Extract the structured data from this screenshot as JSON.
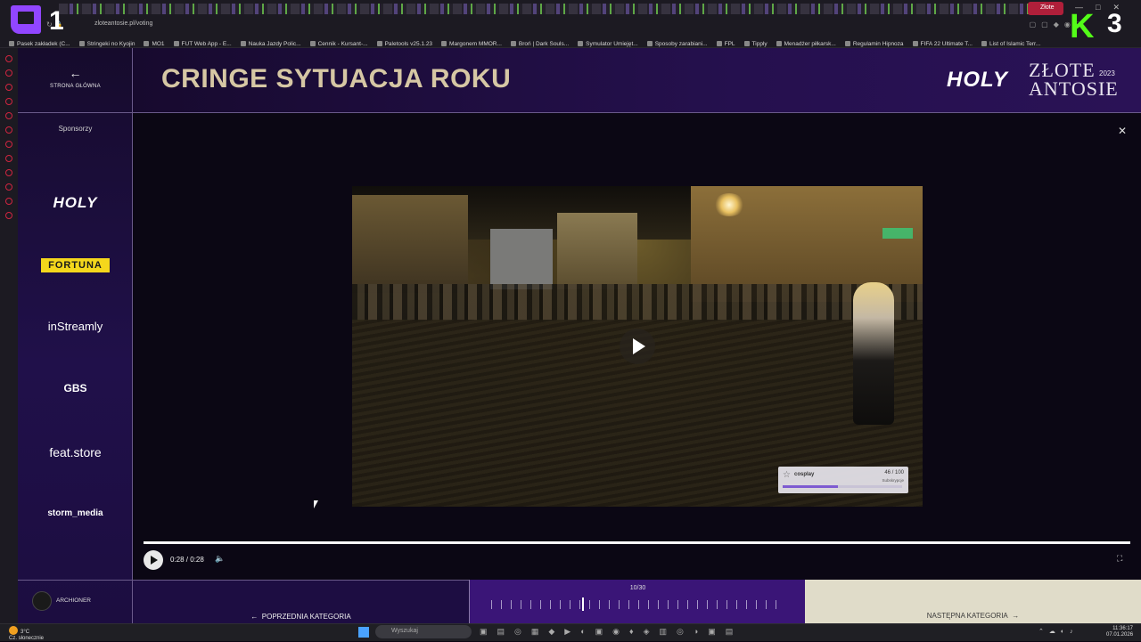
{
  "browser": {
    "url": "zloteantosie.pl/voting",
    "active_tab": "Złote",
    "bookmarks": [
      "Pasek zakładek (C...",
      "Stringeki no Kyojin",
      "MO1",
      "FUT Web App - E...",
      "Nauka Jazdy Polic...",
      "Cennik - Kursant-...",
      "Paletools v25.1.23",
      "Margonem MMOR...",
      "Broń | Dark Souls...",
      "Symulator Umiejęt...",
      "Sposoby zarabiani...",
      "FPL",
      "Tipply",
      "Menadżer piłkarsk...",
      "Regulamin Hipnoza",
      "FIFA 22 Ultimate T...",
      "List of Islamic Terr..."
    ]
  },
  "overlay": {
    "left_number": "1",
    "right_number": "3",
    "right_logo": "K"
  },
  "nav": {
    "home_label": "STRONA GŁÓWNA",
    "sponsors_title": "Sponsorzy"
  },
  "sponsors": {
    "holy": "HOLY",
    "fortuna": "FORTUNA",
    "instreamly": "inStreamly",
    "gbs": "GBS",
    "feat": "feat.store",
    "storm": "storm_media"
  },
  "user": {
    "name": "ARCHIONER"
  },
  "header": {
    "title": "CRINGE SYTUACJA ROKU",
    "brand_holy": "HOLY",
    "brand_line1": "ZŁOTE",
    "brand_line2": "ANTOSIE",
    "brand_year": "2023"
  },
  "video": {
    "overlay_name": "cosplay",
    "overlay_count": "46 / 100",
    "overlay_sub": "Subskrypcje",
    "overlay_progress": 0.46,
    "progress": 1.0,
    "time": "0:28 / 0:28"
  },
  "footer": {
    "prev_label": "POPRZEDNIA KATEGORIA",
    "page_indicator": "10/30",
    "next_label": "NASTĘPNA KATEGORIA"
  },
  "taskbar": {
    "temperature": "3°C",
    "weather": "Cz. słonecznie",
    "search_placeholder": "Wyszukaj",
    "time": "11:36:17",
    "date": "07.01.2026"
  },
  "icons": {
    "home": "arrow-left-icon",
    "close": "close-icon",
    "play": "play-icon",
    "volume": "volume-icon",
    "fullscreen": "fullscreen-icon"
  }
}
